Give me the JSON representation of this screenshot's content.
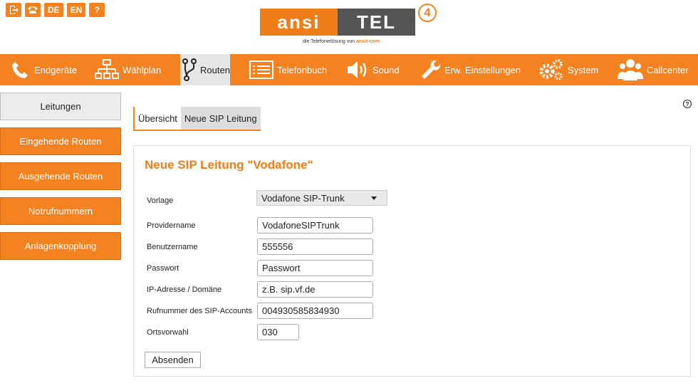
{
  "topbar": {
    "logout_icon": "exit-icon",
    "phone_icon": "phone-icon",
    "lang_de": "DE",
    "lang_en": "EN",
    "help_glyph": "?"
  },
  "logo": {
    "left": "ansi",
    "right": "TEL",
    "number": "4",
    "tagline": "die Telefonielösung von",
    "tagline_brand": "ansit-com"
  },
  "nav": {
    "items": [
      {
        "label": "Endgeräte",
        "icon": "phone-icon"
      },
      {
        "label": "Wählplan",
        "icon": "sitemap-icon"
      },
      {
        "label": "Routen",
        "icon": "route-icon"
      },
      {
        "label": "Telefonbuch",
        "icon": "list-icon"
      },
      {
        "label": "Sound",
        "icon": "speaker-icon"
      },
      {
        "label": "Erw. Einstellungen",
        "icon": "wrench-icon"
      },
      {
        "label": "System",
        "icon": "gears-icon"
      },
      {
        "label": "Callcenter",
        "icon": "users-icon"
      }
    ],
    "active": "Routen"
  },
  "sidebar": {
    "items": [
      {
        "label": "Leitungen"
      },
      {
        "label": "Eingehende Routen"
      },
      {
        "label": "Ausgehende Routen"
      },
      {
        "label": "Notrufnummern"
      },
      {
        "label": "Anlagenkopplung"
      }
    ],
    "active": "Leitungen"
  },
  "help_glyph": "?",
  "tabs": [
    {
      "label": "Übersicht"
    },
    {
      "label": "Neue SIP Leitung"
    }
  ],
  "form": {
    "title": "Neue SIP Leitung \"Vodafone\"",
    "vorlage_label": "Vorlage",
    "vorlage_value": "Vodafone SIP-Trunk",
    "fields": [
      {
        "label": "Providername",
        "value": "VodafoneSIPTrunk"
      },
      {
        "label": "Benutzername",
        "value": "555556"
      },
      {
        "label": "Passwort",
        "value": "Passwort"
      },
      {
        "label": "IP-Adresse / Domäne",
        "value": "z.B. sip.vf.de"
      },
      {
        "label": "Rufnummer des SIP-Accounts",
        "value": "004930585834930"
      },
      {
        "label": "Ortsvorwahl",
        "value": "030"
      }
    ],
    "submit_label": "Absenden"
  },
  "colors": {
    "accent": "#f58220",
    "title": "#ef7d1a"
  }
}
